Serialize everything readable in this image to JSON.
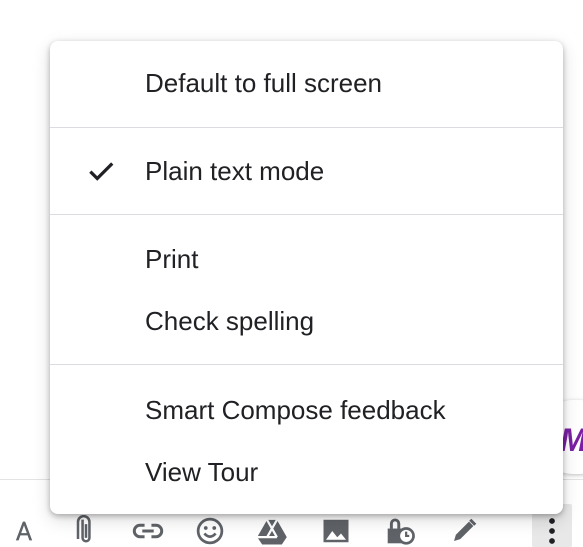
{
  "menu": {
    "items": [
      {
        "label": "Default to full screen",
        "checked": false
      },
      {
        "label": "Plain text mode",
        "checked": true
      },
      {
        "label": "Print",
        "checked": false
      },
      {
        "label": "Check spelling",
        "checked": false
      },
      {
        "label": "Smart Compose feedback",
        "checked": false
      },
      {
        "label": "View Tour",
        "checked": false
      }
    ]
  },
  "toolbar": {
    "icons": [
      "formatting-options-icon",
      "attach-file-icon",
      "insert-link-icon",
      "insert-emoji-icon",
      "google-drive-icon",
      "insert-photo-icon",
      "confidential-mode-icon",
      "signature-icon",
      "more-options-icon"
    ]
  },
  "colors": {
    "text": "#202124",
    "icon": "#5f6368",
    "divider": "#dadce0",
    "more_button_bg": "#e8e8e8",
    "edge_logo": "#7b1fa2"
  }
}
